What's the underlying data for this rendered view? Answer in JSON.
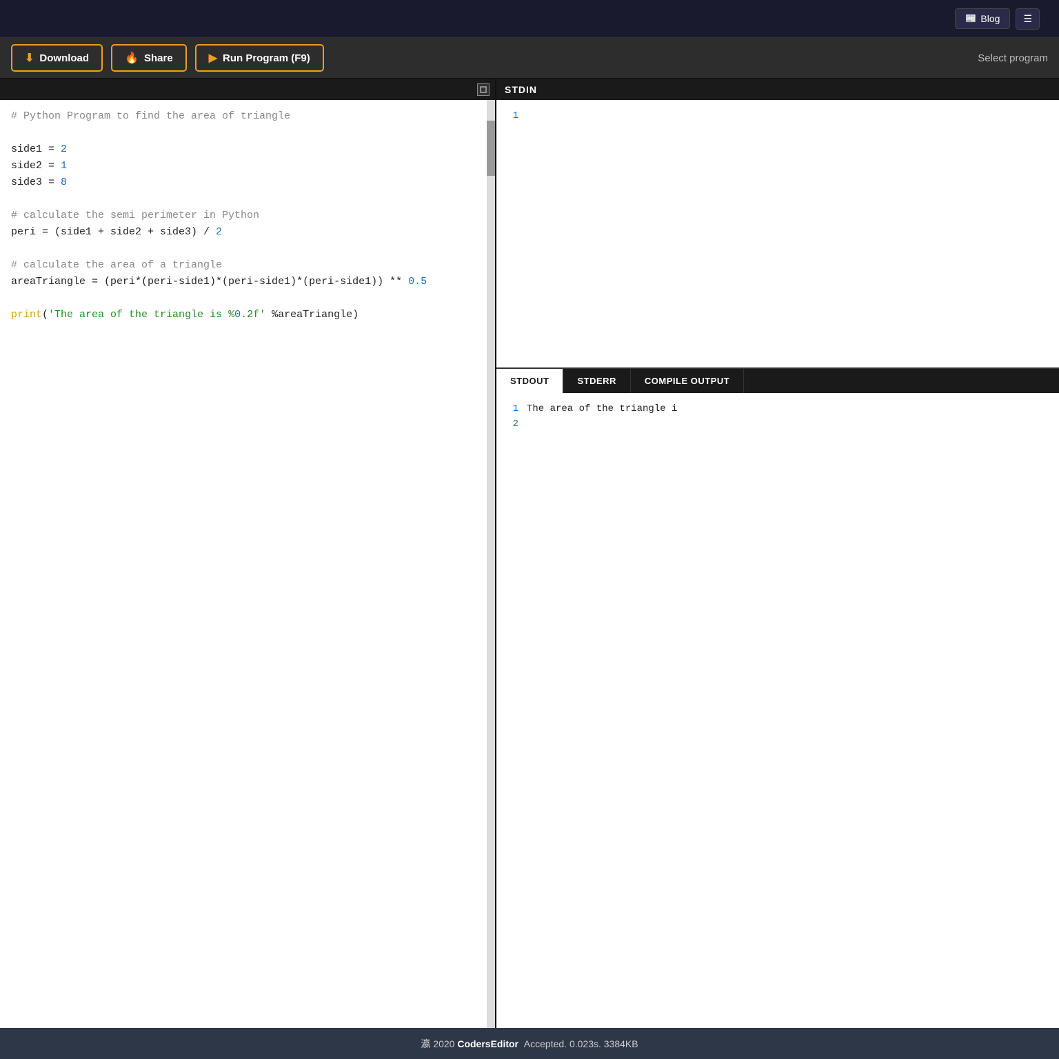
{
  "nav": {
    "blog_label": "Blog",
    "blog_icon": "📰"
  },
  "toolbar": {
    "download_label": "Download",
    "share_label": "Share",
    "run_label": "Run Program (F9)",
    "select_program_placeholder": "Select program"
  },
  "editor": {
    "code_lines": [
      "# Python Program to find the area of triangle",
      "",
      "side1 = 2",
      "side2 = 1",
      "side3 = 8",
      "",
      "# calculate the semi perimeter in Python",
      "peri = (side1 + side2 + side3) / 2",
      "",
      "# calculate the area of a triangle",
      "areaTriangle = (peri*(peri-side1)*(peri-side1)*(peri-side1)) ** 0.5",
      "",
      "print('The area of the triangle is %0.2f' %areaTriangle)"
    ]
  },
  "stdin": {
    "label": "STDIN",
    "line1": "1"
  },
  "output": {
    "tabs": [
      {
        "id": "stdout",
        "label": "STDOUT",
        "active": true
      },
      {
        "id": "stderr",
        "label": "STDERR",
        "active": false
      },
      {
        "id": "compile",
        "label": "COMPILE OUTPUT",
        "active": false
      }
    ],
    "lines": [
      {
        "num": "1",
        "text": "The area of the triangle i"
      },
      {
        "num": "2",
        "text": ""
      }
    ]
  },
  "footer": {
    "copyright": "瀛 2020",
    "app_name": "CodersEditor",
    "status": "Accepted. 0.023s. 3384KB"
  }
}
